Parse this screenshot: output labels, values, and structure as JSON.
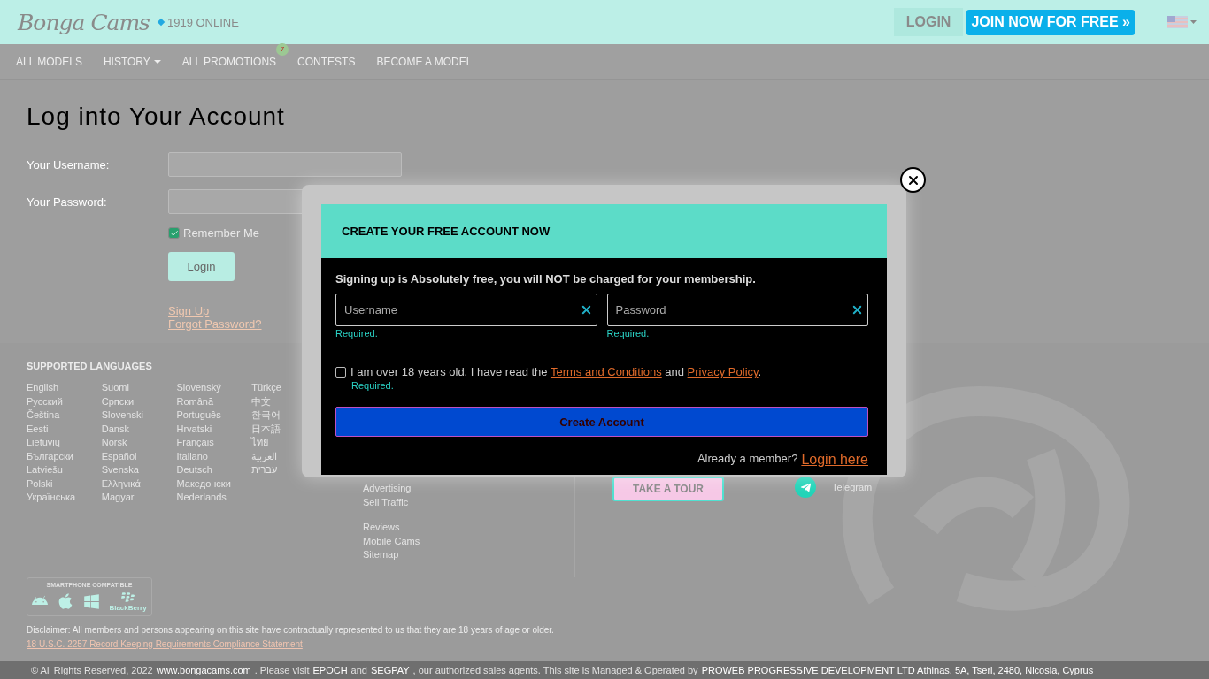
{
  "header": {
    "logo": "Bonga Cams",
    "online": "1919 ONLINE",
    "login_button": "LOGIN",
    "join_button": "JOIN NOW FOR FREE »"
  },
  "nav": [
    {
      "label": "ALL MODELS",
      "dropdown": false
    },
    {
      "label": "HISTORY",
      "dropdown": true
    },
    {
      "label": "ALL PROMOTIONS",
      "dropdown": false,
      "badge": "7"
    },
    {
      "label": "CONTESTS",
      "dropdown": false
    },
    {
      "label": "BECOME A MODEL",
      "dropdown": false
    }
  ],
  "login_form": {
    "title": "Log into Your Account",
    "fields": [
      {
        "label": "Your Username:"
      },
      {
        "label": "Your Password:"
      }
    ],
    "remember": {
      "label": "Remember Me",
      "checked": true
    },
    "submit": "Login",
    "links": [
      "Sign Up",
      "Forgot Password?"
    ]
  },
  "footer": {
    "languages_title": "SUPPORTED LANGUAGES",
    "languages": [
      [
        "English",
        "Русский",
        "Čeština",
        "Eesti",
        "Lietuvių",
        "Български",
        "Latviešu",
        "Polski",
        "Українська"
      ],
      [
        "Suomi",
        "Српски",
        "Slovenski",
        "Dansk",
        "Norsk",
        "Español",
        "Svenska",
        "Ελληνικά",
        "Magyar"
      ],
      [
        "Slovenský",
        "Română",
        "Português",
        "Hrvatski",
        "Français",
        "Italiano",
        "Deutsch",
        "Македонски",
        "Nederlands"
      ],
      [
        "Türkçe",
        "中文",
        "한국어",
        "日本語",
        "ไทย",
        "العربية",
        "עברית"
      ]
    ],
    "link_groups": [
      [
        "Advertising",
        "Sell Traffic"
      ],
      [
        "Reviews",
        "Mobile Cams",
        "Sitemap"
      ]
    ],
    "tour_button": "TAKE A TOUR",
    "social": [
      {
        "label": "Telegram"
      }
    ],
    "smartphone": {
      "title": "SMARTPHONE COMPATIBLE",
      "blackberry": "BlackBerry"
    },
    "disclaimer": "Disclaimer: All members and persons appearing on this site have contractually represented to us that they are 18 years of age or older.",
    "compliance_link": "18 U.S.C. 2257 Record Keeping Requirements Compliance Statement",
    "copyright": [
      {
        "text": "© All Rights Reserved, 2022",
        "link": false
      },
      {
        "text": "www.bongacams.com",
        "link": true
      },
      {
        "text": ". Please visit",
        "link": false
      },
      {
        "text": "EPOCH",
        "link": true
      },
      {
        "text": "and",
        "link": false
      },
      {
        "text": "SEGPAY",
        "link": true
      },
      {
        "text": ", our authorized sales agents. This site is Managed & Operated by",
        "link": false
      },
      {
        "text": "PROWEB PROGRESSIVE DEVELOPMENT LTD Athinas, 5A, Tseri, 2480, Nicosia, Cyprus",
        "link": true
      }
    ]
  },
  "modal": {
    "title": "CREATE YOUR FREE ACCOUNT NOW",
    "intro": "Signing up is Absolutely free, you will NOT be charged for your membership.",
    "fields": [
      {
        "placeholder": "Username",
        "error": "Required."
      },
      {
        "placeholder": "Password",
        "error": "Required."
      }
    ],
    "agree": {
      "checked": false,
      "parts": [
        {
          "text": "I am over 18 years old. I have read the",
          "link": false
        },
        {
          "text": "Terms and Conditions",
          "link": true
        },
        {
          "text": "and",
          "link": false
        },
        {
          "text": "Privacy Policy",
          "link": true
        },
        {
          "text": ".",
          "link": false
        }
      ],
      "error": "Required."
    },
    "submit": "Create Account",
    "member_text": "Already a member?",
    "login_link": "Login here"
  }
}
